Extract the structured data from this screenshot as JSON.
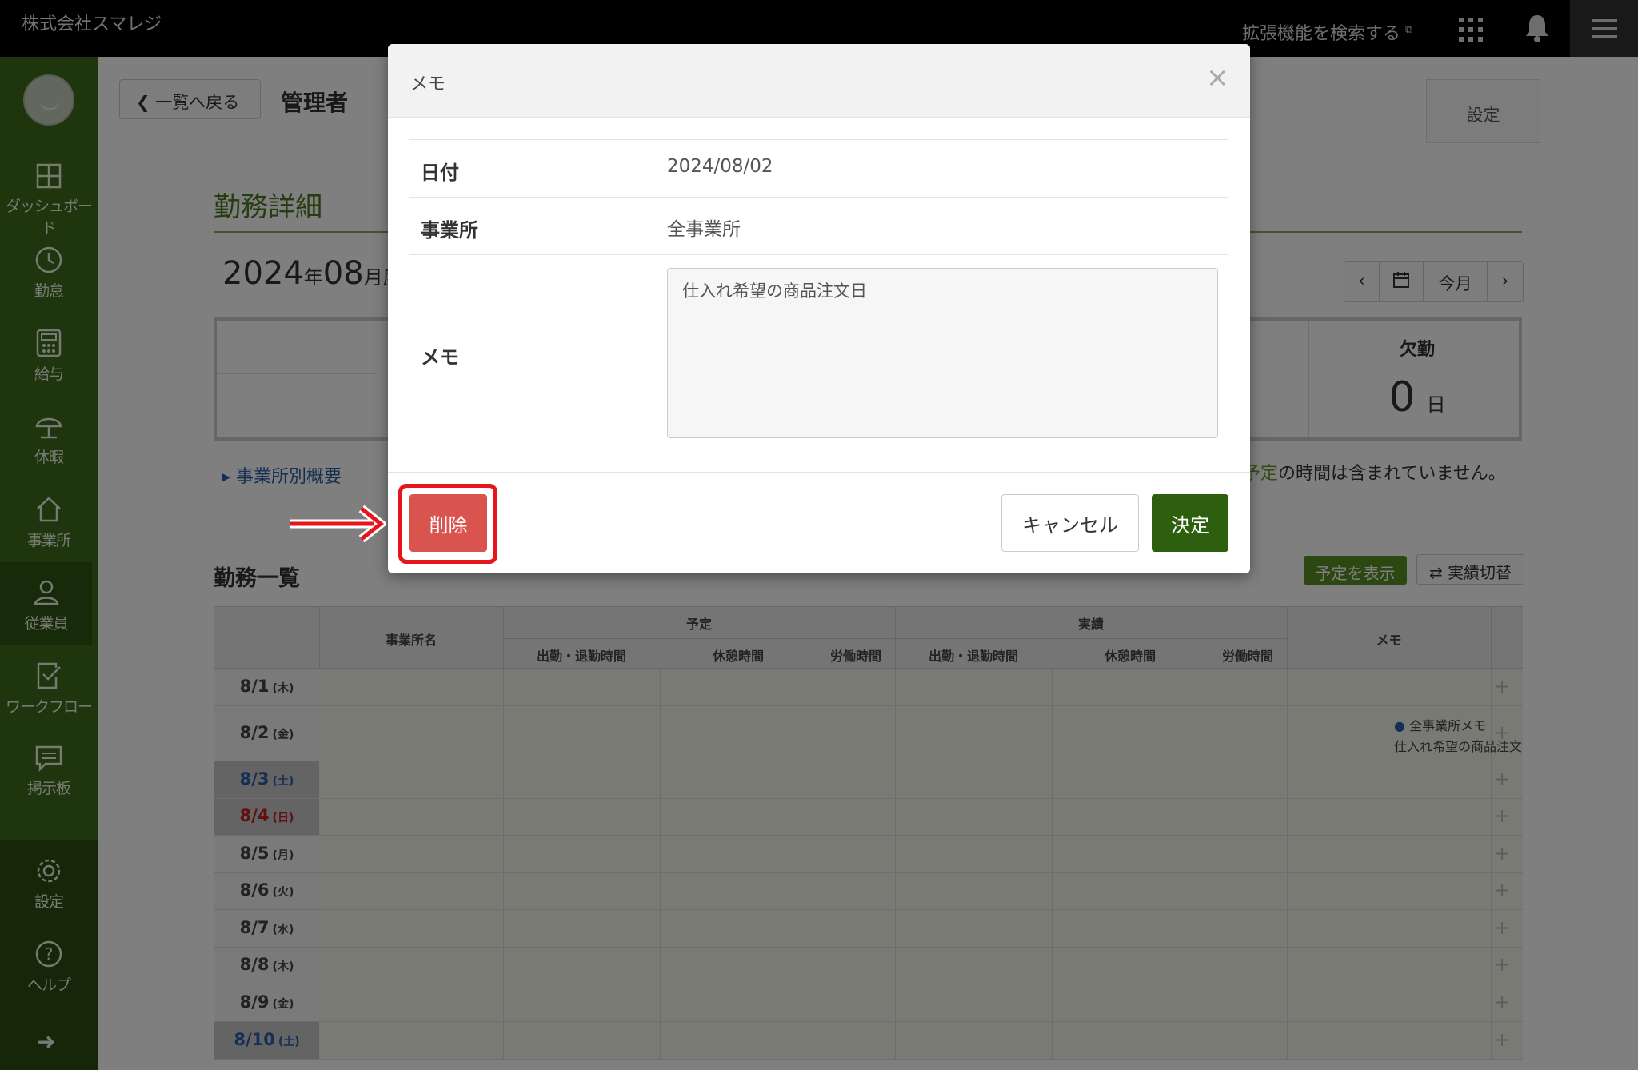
{
  "topbar": {
    "company": "株式会社スマレジ",
    "extensions_search": "拡張機能を検索する",
    "extensions_icon": "external-link-icon",
    "apps_icon": "grid-apps-icon",
    "bell_icon": "bell-icon",
    "menu_icon": "hamburger-menu-icon"
  },
  "sidebar": {
    "items": [
      {
        "label": "ダッシュボード",
        "icon": "dashboard-icon"
      },
      {
        "label": "勤怠",
        "icon": "clock-icon"
      },
      {
        "label": "給与",
        "icon": "calculator-icon"
      },
      {
        "label": "休暇",
        "icon": "umbrella-icon"
      },
      {
        "label": "事業所",
        "icon": "home-icon"
      },
      {
        "label": "従業員",
        "icon": "person-icon"
      },
      {
        "label": "ワークフロー",
        "icon": "checklist-icon"
      },
      {
        "label": "掲示板",
        "icon": "message-icon"
      },
      {
        "label": "設定",
        "icon": "gear-icon"
      },
      {
        "label": "ヘルプ",
        "icon": "help-icon"
      }
    ],
    "active": "従業員"
  },
  "header": {
    "back_label": "一覧へ戻る",
    "title": "管理者",
    "settings_label": "設定"
  },
  "detail": {
    "section_title": "勤務詳細",
    "month_year": "2024",
    "month_year_unit": "年",
    "month_num": "08",
    "month_unit": "月度",
    "nav_prev": "‹",
    "nav_today": "今月",
    "nav_next": "›",
    "absence_label": "欠勤",
    "absence_value": "0",
    "absence_unit": "日",
    "office_summary_link": "事業所別概要",
    "note_green": "予定",
    "note_rest": "の時間は含まれていません。"
  },
  "list": {
    "title": "勤務一覧",
    "show_plan": "予定を表示",
    "toggle": "実績切替",
    "headers": {
      "office": "事業所名",
      "plan": "予定",
      "actual": "実績",
      "memo": "メモ",
      "in_out": "出勤・退勤時間",
      "break": "休憩時間",
      "work": "労働時間"
    },
    "rows": [
      {
        "date": "8/1",
        "dow": "(木)",
        "type": "weekday",
        "memo_title": "",
        "memo_text": ""
      },
      {
        "date": "8/2",
        "dow": "(金)",
        "type": "weekday",
        "memo_title": "全事業所メモ",
        "memo_text": "仕入れ希望の商品注文日"
      },
      {
        "date": "8/3",
        "dow": "(土)",
        "type": "sat",
        "memo_title": "",
        "memo_text": ""
      },
      {
        "date": "8/4",
        "dow": "(日)",
        "type": "sun",
        "memo_title": "",
        "memo_text": ""
      },
      {
        "date": "8/5",
        "dow": "(月)",
        "type": "weekday",
        "memo_title": "",
        "memo_text": ""
      },
      {
        "date": "8/6",
        "dow": "(火)",
        "type": "weekday",
        "memo_title": "",
        "memo_text": ""
      },
      {
        "date": "8/7",
        "dow": "(水)",
        "type": "weekday",
        "memo_title": "",
        "memo_text": ""
      },
      {
        "date": "8/8",
        "dow": "(木)",
        "type": "weekday",
        "memo_title": "",
        "memo_text": ""
      },
      {
        "date": "8/9",
        "dow": "(金)",
        "type": "weekday",
        "memo_title": "",
        "memo_text": ""
      },
      {
        "date": "8/10",
        "dow": "(土)",
        "type": "sat",
        "memo_title": "",
        "memo_text": ""
      }
    ]
  },
  "modal": {
    "title": "メモ",
    "close": "×",
    "date_label": "日付",
    "date_value": "2024/08/02",
    "office_label": "事業所",
    "office_value": "全事業所",
    "memo_label": "メモ",
    "memo_value": "仕入れ希望の商品注文日",
    "delete": "削除",
    "cancel": "キャンセル",
    "ok": "決定"
  },
  "colors": {
    "sidebar": "#3d6b1a",
    "delete": "#d9534f",
    "ok": "#2e5f0e",
    "annotation": "#e8141b"
  }
}
